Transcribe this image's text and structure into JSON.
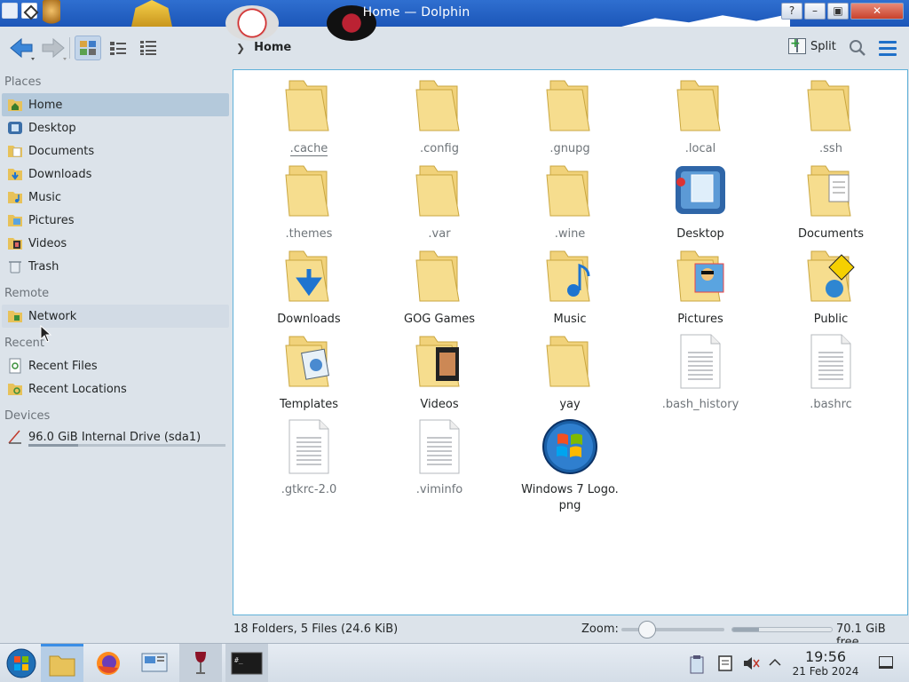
{
  "window": {
    "title": "Home — Dolphin",
    "buttons": {
      "help": "?",
      "minimize": "–",
      "maximize": "▣",
      "close": "✕"
    }
  },
  "toolbar": {
    "breadcrumb": [
      "Home"
    ],
    "split_label": "Split"
  },
  "sidebar": {
    "sections": [
      {
        "title": "Places",
        "items": [
          {
            "label": "Home",
            "icon": "home-folder-icon",
            "active": true
          },
          {
            "label": "Desktop",
            "icon": "desktop-icon"
          },
          {
            "label": "Documents",
            "icon": "documents-folder-icon"
          },
          {
            "label": "Downloads",
            "icon": "downloads-folder-icon"
          },
          {
            "label": "Music",
            "icon": "music-folder-icon"
          },
          {
            "label": "Pictures",
            "icon": "pictures-folder-icon"
          },
          {
            "label": "Videos",
            "icon": "videos-folder-icon"
          },
          {
            "label": "Trash",
            "icon": "trash-icon"
          }
        ]
      },
      {
        "title": "Remote",
        "items": [
          {
            "label": "Network",
            "icon": "network-folder-icon"
          }
        ]
      },
      {
        "title": "Recent",
        "items": [
          {
            "label": "Recent Files",
            "icon": "recent-files-icon"
          },
          {
            "label": "Recent Locations",
            "icon": "recent-locations-icon"
          }
        ]
      },
      {
        "title": "Devices",
        "items": [
          {
            "label": "96.0 GiB Internal Drive (sda1)",
            "icon": "hard-drive-icon",
            "usage_fraction": 0.25
          }
        ]
      }
    ]
  },
  "files": [
    {
      "name": ".cache",
      "type": "folder",
      "hidden": true,
      "underlined": true
    },
    {
      "name": ".config",
      "type": "folder",
      "hidden": true
    },
    {
      "name": ".gnupg",
      "type": "folder",
      "hidden": true
    },
    {
      "name": ".local",
      "type": "folder",
      "hidden": true
    },
    {
      "name": ".ssh",
      "type": "folder",
      "hidden": true
    },
    {
      "name": ".themes",
      "type": "folder",
      "hidden": true
    },
    {
      "name": ".var",
      "type": "folder",
      "hidden": true
    },
    {
      "name": ".wine",
      "type": "folder",
      "hidden": true
    },
    {
      "name": "Desktop",
      "type": "desktop"
    },
    {
      "name": "Documents",
      "type": "folder-documents"
    },
    {
      "name": "Downloads",
      "type": "folder-downloads"
    },
    {
      "name": "GOG Games",
      "type": "folder"
    },
    {
      "name": "Music",
      "type": "folder-music"
    },
    {
      "name": "Pictures",
      "type": "folder-pictures"
    },
    {
      "name": "Public",
      "type": "folder-public"
    },
    {
      "name": "Templates",
      "type": "folder-templates"
    },
    {
      "name": "Videos",
      "type": "folder-videos"
    },
    {
      "name": "yay",
      "type": "folder"
    },
    {
      "name": ".bash_history",
      "type": "text",
      "hidden": true
    },
    {
      "name": ".bashrc",
      "type": "text",
      "hidden": true
    },
    {
      "name": ".gtkrc-2.0",
      "type": "text",
      "hidden": true
    },
    {
      "name": ".viminfo",
      "type": "text",
      "hidden": true
    },
    {
      "name": "Windows 7 Logo.\npng",
      "type": "image"
    }
  ],
  "status": {
    "summary": "18 Folders, 5 Files (24.6 KiB)",
    "zoom_label": "Zoom:",
    "zoom_fraction": 0.2,
    "free_space": "70.1 GiB free",
    "used_fraction": 0.27
  },
  "taskbar": {
    "apps": [
      {
        "name": "start-menu",
        "icon": "windows-logo-icon"
      },
      {
        "name": "dolphin",
        "icon": "file-manager-icon",
        "active": true
      },
      {
        "name": "firefox",
        "icon": "firefox-icon"
      },
      {
        "name": "system-settings",
        "icon": "system-settings-icon"
      },
      {
        "name": "wine",
        "icon": "wine-glass-icon",
        "open": true
      },
      {
        "name": "terminal",
        "icon": "terminal-icon",
        "open": true
      }
    ],
    "clock": {
      "time": "19:56",
      "date": "21 Feb 2024"
    }
  }
}
